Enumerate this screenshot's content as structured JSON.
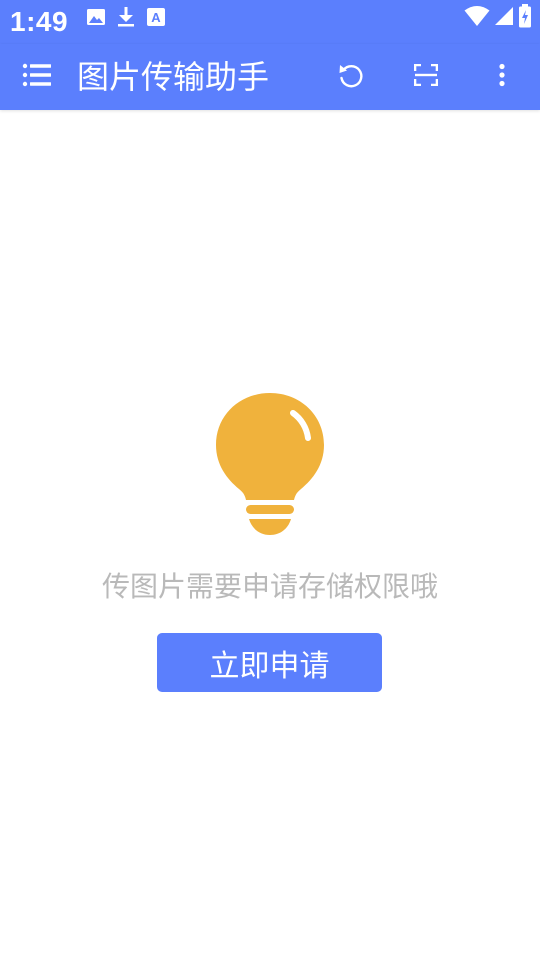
{
  "status_bar": {
    "time": "1:49",
    "left_icons": [
      "image-icon",
      "download-icon",
      "text-a-icon"
    ],
    "right_icons": [
      "wifi-icon",
      "cell-signal-icon",
      "battery-charging-icon"
    ]
  },
  "app_bar": {
    "title": "图片传输助手",
    "menu_icon": "menu-list-icon",
    "actions": [
      "refresh-icon",
      "scan-frame-icon",
      "more-vert-icon"
    ]
  },
  "main": {
    "illustration_icon": "lightbulb-icon",
    "message": "传图片需要申请存储权限哦",
    "button_label": "立即申请"
  },
  "colors": {
    "primary": "#5b7ffd",
    "bulb": "#f0b23c",
    "message_text": "#b9b9b9",
    "background": "#ffffff"
  }
}
